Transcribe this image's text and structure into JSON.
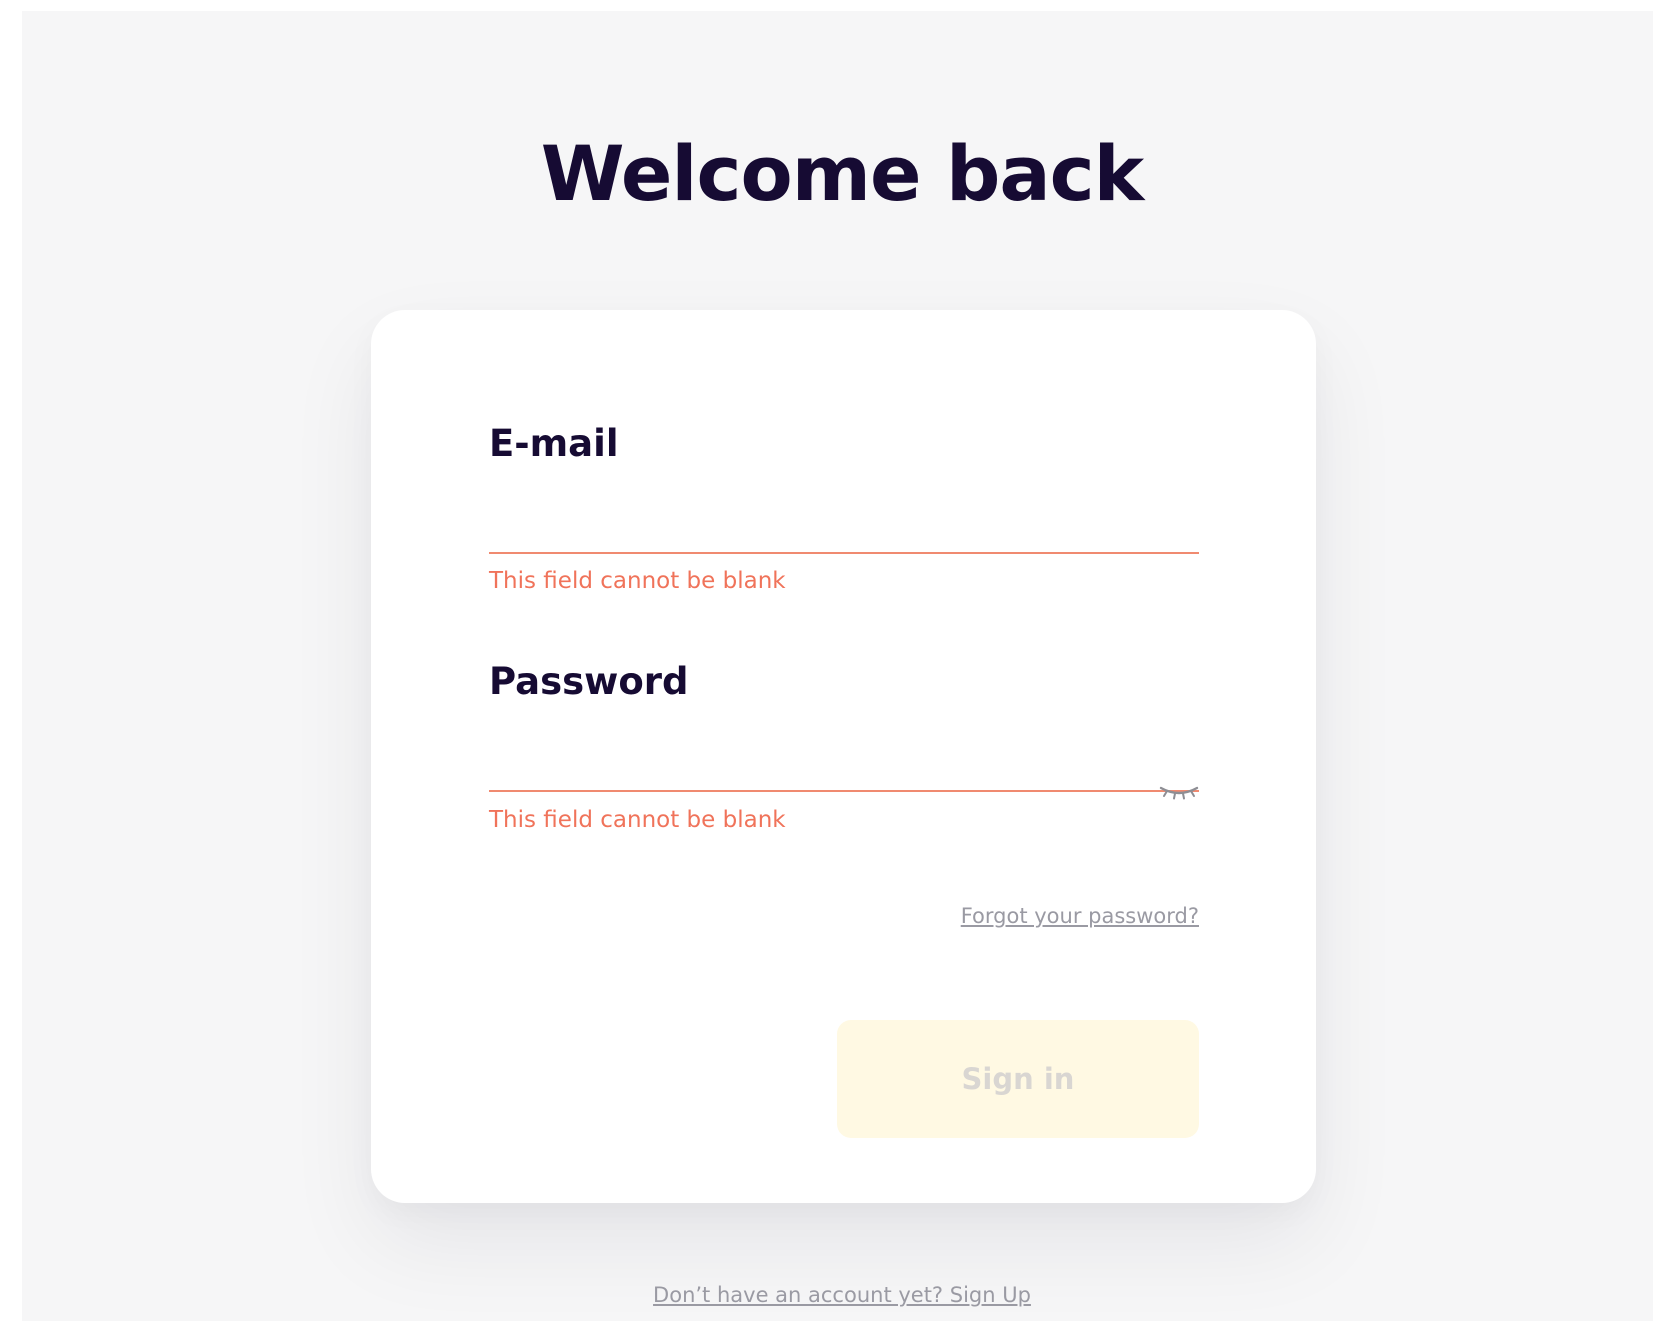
{
  "page": {
    "title": "Welcome back"
  },
  "form": {
    "email_label": "E-mail",
    "email_value": "",
    "email_error": "This field cannot be blank",
    "password_label": "Password",
    "password_value": "",
    "password_error": "This field cannot be blank",
    "password_toggle_icon": "eye-closed-icon",
    "forgot_link": "Forgot your password?",
    "submit_label": "Sign in"
  },
  "footer": {
    "signup_link": "Don’t have an account yet? Sign Up"
  },
  "colors": {
    "background": "#f6f6f7",
    "heading": "#160b33",
    "error": "#f0735a",
    "button_disabled_bg": "#fff9e3",
    "button_disabled_text": "#d9d6d2",
    "link": "#9a9aa3"
  }
}
